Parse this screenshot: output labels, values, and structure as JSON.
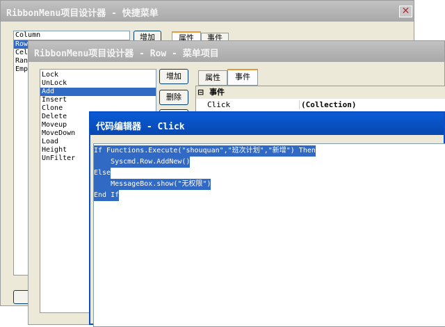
{
  "win1": {
    "title": "RibbonMenu项目设计器 - 快捷菜单",
    "input_value": "Column",
    "list_items": [
      "Row",
      "Cell",
      "Rang",
      "Emp"
    ],
    "add_label": "增加",
    "tab_properties": "属性",
    "tab_events": "事件"
  },
  "win2": {
    "title": "RibbonMenu项目设计器 - Row - 菜单项目",
    "list_items": [
      "Lock",
      "UnLock",
      "Add",
      "Insert",
      "Clone",
      "Delete",
      "Moveup",
      "MoveDown",
      "Load",
      "Height",
      "UnFilter"
    ],
    "selected_index": 2,
    "add_label": "增加",
    "delete_label": "删除",
    "tab_properties": "属性",
    "tab_events": "事件",
    "category": "事件",
    "collapse_glyph": "⊟",
    "prop_name": "Click",
    "prop_value": "(Collection)"
  },
  "win3": {
    "title": "代码编辑器 - Click",
    "code_lines": [
      "If Functions.Execute(\"shouquan\",\"班次计划\",\"新增\") Then",
      "    Syscmd.Row.AddNew()",
      "Else",
      "    MessageBox.show(\"无权限\")",
      "End If"
    ]
  },
  "colors": {
    "selection": "#316ac5",
    "active_title": "#0a5bd6",
    "inactive_title": "#b0b0b0",
    "face": "#ece9d8"
  }
}
